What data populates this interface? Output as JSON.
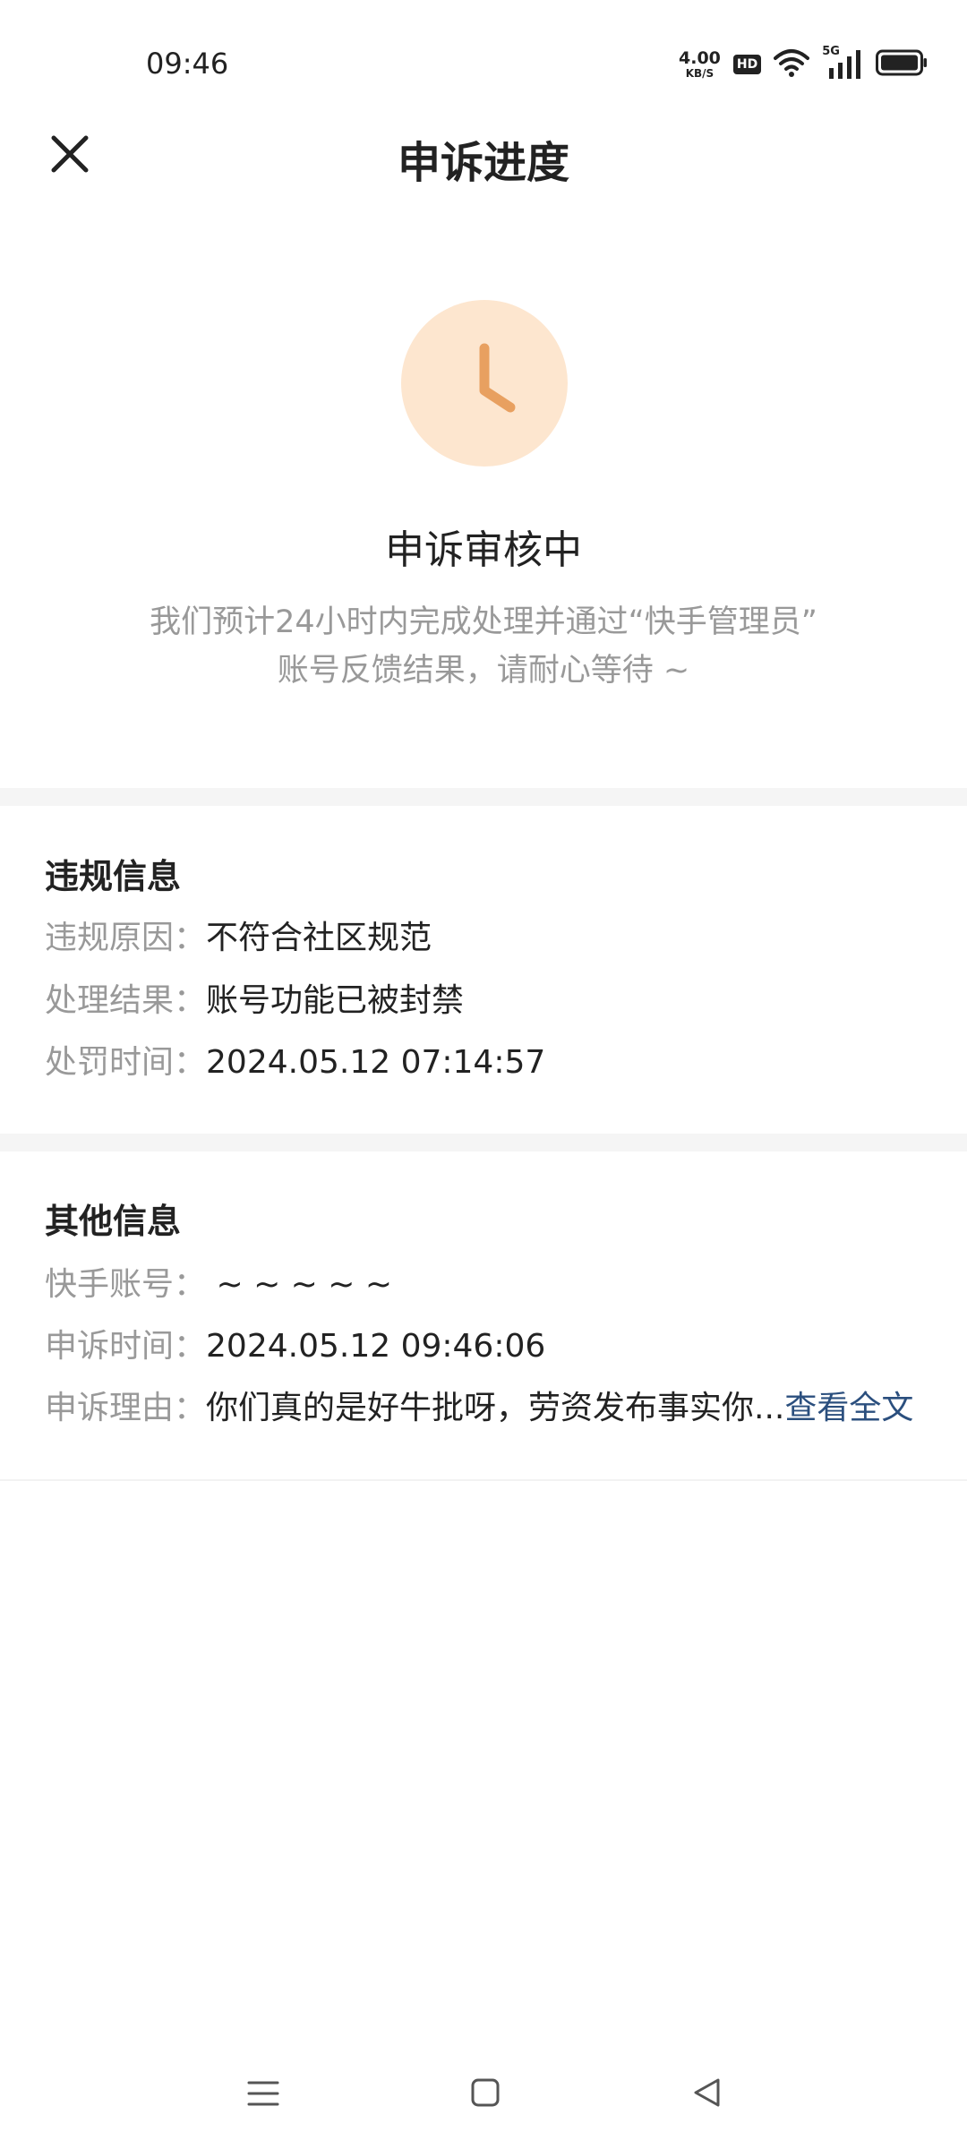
{
  "status_bar": {
    "time": "09:46",
    "net_speed_value": "4.00",
    "net_speed_unit": "KB/S",
    "hd_badge": "HD",
    "network_type": "5G",
    "icons": [
      "wifi-icon",
      "signal-icon",
      "battery-icon"
    ]
  },
  "header": {
    "title": "申诉进度",
    "close_icon": "close-icon"
  },
  "status": {
    "icon": "clock-icon",
    "icon_bg_color": "#fde6cf",
    "icon_color": "#e8a060",
    "title": "申诉审核中",
    "desc_line1": "我们预计24小时内完成处理并通过“快手管理员”",
    "desc_line2": "账号反馈结果，请耐心等待 ~"
  },
  "violation": {
    "title": "违规信息",
    "rows": [
      {
        "label": "违规原因：",
        "value": "不符合社区规范"
      },
      {
        "label": "处理结果：",
        "value": "账号功能已被封禁"
      },
      {
        "label": "处罚时间：",
        "value": "2024.05.12 07:14:57"
      }
    ]
  },
  "other": {
    "title": "其他信息",
    "rows": [
      {
        "label": "快手账号：",
        "value": " ~ ~ ~ ~ ~"
      },
      {
        "label": "申诉时间：",
        "value": "2024.05.12 09:46:06"
      },
      {
        "label": "申诉理由：",
        "value": "你们真的是好牛批呀，劳资发布事实你...",
        "link": "查看全文"
      }
    ],
    "link_color": "#2b4f7e"
  },
  "nav_bar": {
    "icons": [
      "menu-icon",
      "home-icon",
      "back-icon"
    ]
  }
}
